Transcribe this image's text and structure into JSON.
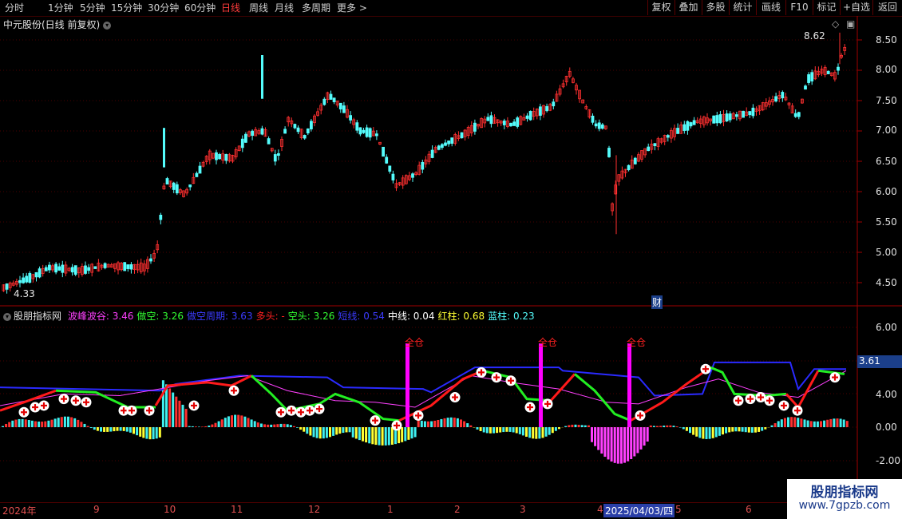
{
  "toolbar": {
    "periods": [
      "分时",
      "1分钟",
      "5分钟",
      "15分钟",
      "30分钟",
      "60分钟",
      "日线",
      "周线",
      "月线",
      "多周期",
      "更多 >"
    ],
    "active": "日线",
    "right_buttons": [
      "复权",
      "叠加",
      "多股",
      "统计",
      "画线",
      "F10",
      "标记",
      "+自选",
      "返回"
    ]
  },
  "main": {
    "title": "中元股份(日线 前复权)",
    "price_axis": [
      "8.50",
      "8.00",
      "7.50",
      "7.00",
      "6.50",
      "6.00",
      "5.50",
      "5.00",
      "4.50"
    ],
    "high_label": "8.62",
    "low_label": "4.33",
    "fin_marker": "财"
  },
  "indicator": {
    "name": "股朋指标网",
    "items": [
      {
        "label": "波峰波谷:",
        "value": "3.46",
        "color": "#ff40ff"
      },
      {
        "label": "做空:",
        "value": "3.26",
        "color": "#33ff33"
      },
      {
        "label": "做空周期:",
        "value": "3.63",
        "color": "#3b3bff"
      },
      {
        "label": "多头:",
        "value": "-",
        "color": "#ff2020"
      },
      {
        "label": "空头:",
        "value": "3.26",
        "color": "#33ff33"
      },
      {
        "label": "短线:",
        "value": "0.54",
        "color": "#3b3bff"
      },
      {
        "label": "中线:",
        "value": "0.04",
        "color": "#ffffff"
      },
      {
        "label": "红柱:",
        "value": "0.68",
        "color": "#ffff33"
      },
      {
        "label": "蓝柱:",
        "value": "0.23",
        "color": "#55ffff"
      }
    ],
    "axis": [
      "6.00",
      "4.00",
      "2.00",
      "0.00",
      "-2.00"
    ],
    "current_value": "3.61",
    "full_label": "全仓"
  },
  "timeline": {
    "labels": [
      "2024年",
      "9",
      "10",
      "11",
      "12",
      "1",
      "2",
      "3",
      "4",
      "2025/04/03/四",
      "5",
      "6"
    ]
  },
  "colors": {
    "up": "#ff3030",
    "down": "#54fcfc",
    "axis": "#a00000",
    "bull": "#ff1a1a",
    "bear": "#22ee22",
    "period": "#2a2aff",
    "wave": "#ff40ff",
    "full": "#ff00ff"
  },
  "watermark": {
    "title": "股朋指标网",
    "url": "www.7gpzb.com"
  }
}
